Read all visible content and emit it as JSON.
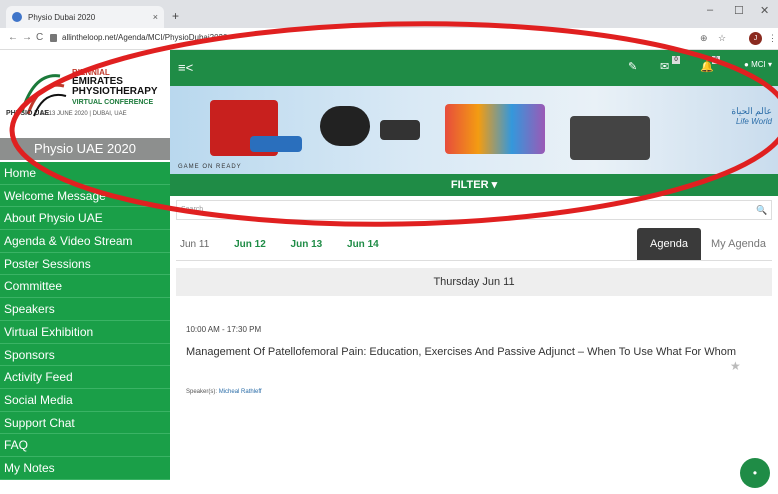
{
  "browser": {
    "tab_title": "Physio Dubai 2020",
    "tab_close": "×",
    "new_tab": "+",
    "win_min": "–",
    "win_max": "☐",
    "win_close": "✕",
    "back": "←",
    "forward": "→",
    "reload": "C",
    "url": "allintheloop.net/Agenda/MCI/PhysioDubai2020",
    "profile_initial": "J",
    "menu": "⋮"
  },
  "logo": {
    "line1": "BIENNIAL",
    "line2": "EMIRATES",
    "line3": "PHYSIOTHERAPY",
    "line4": "VIRTUAL CONFERENCE",
    "brand": "PHYSIO UAE",
    "dates": "12-13 JUNE 2020 | DUBAI, UAE"
  },
  "sidebar": {
    "event_title": "Physio UAE 2020",
    "items": [
      {
        "label": "Home"
      },
      {
        "label": "Welcome Message"
      },
      {
        "label": "About Physio UAE"
      },
      {
        "label": "Agenda & Video Stream"
      },
      {
        "label": "Poster Sessions"
      },
      {
        "label": "Committee"
      },
      {
        "label": "Speakers"
      },
      {
        "label": "Virtual Exhibition"
      },
      {
        "label": "Sponsors"
      },
      {
        "label": "Activity Feed"
      },
      {
        "label": "Social Media"
      },
      {
        "label": "Support Chat"
      },
      {
        "label": "FAQ"
      },
      {
        "label": "My Notes"
      }
    ]
  },
  "topbar": {
    "hamburger": "≡<",
    "edit_icon": "✎",
    "mail_icon": "✉",
    "mail_badge": "0",
    "bell_icon": "🔔",
    "bell_badge": "0",
    "user_label": "MCI"
  },
  "banner": {
    "bottom_text": "GAME ON READY",
    "life_world_ar": "عالم الحياة",
    "life_world_en": "Life World"
  },
  "filter": {
    "label": "FILTER ▾"
  },
  "search": {
    "placeholder": "Search",
    "icon": "🔍"
  },
  "days": [
    "Jun 11",
    "Jun 12",
    "Jun 13",
    "Jun 14"
  ],
  "tabs": {
    "agenda": "Agenda",
    "my_agenda": "My Agenda"
  },
  "day_header": "Thursday Jun 11",
  "session": {
    "time": "10:00 AM - 17:30 PM",
    "title": "Management Of Patellofemoral Pain: Education, Exercises And Passive Adjunct – When To Use What For Whom",
    "speaker_label": "Speaker(s):",
    "speaker_name": "Micheal Rathleff"
  },
  "fab": "•",
  "colors": {
    "green": "#1f8c46",
    "sidebar_green": "#1a9f48",
    "annotation_red": "#e02020"
  }
}
